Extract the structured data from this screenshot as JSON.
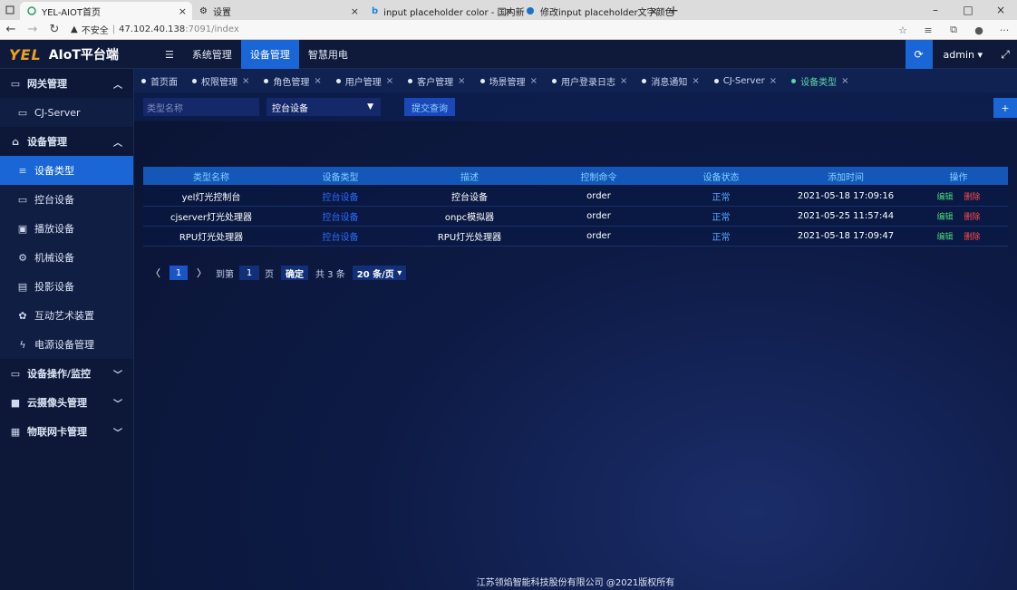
{
  "browser": {
    "tabs": [
      {
        "label": "YEL-AIOT首页",
        "active": true
      },
      {
        "label": "设置",
        "active": false
      },
      {
        "label": "input placeholder color - 国内新",
        "active": false
      },
      {
        "label": "修改input placeholder文字颜色",
        "active": false
      }
    ],
    "security": "不安全",
    "host": "47.102.40.138",
    "path": ":7091/index"
  },
  "header": {
    "brand": "YEL",
    "title": "AIoT平台端",
    "menu": [
      "系统管理",
      "设备管理",
      "智慧用电"
    ],
    "active_menu": "设备管理",
    "user": "admin"
  },
  "sidebar": {
    "items": [
      {
        "label": "网关管理",
        "icon": "monitor-icon",
        "type": "group",
        "expanded": true
      },
      {
        "label": "CJ-Server",
        "icon": "monitor-icon",
        "type": "sub"
      },
      {
        "label": "设备管理",
        "icon": "home-icon",
        "type": "group",
        "expanded": true
      },
      {
        "label": "设备类型",
        "icon": "list-icon",
        "type": "sub",
        "active": true
      },
      {
        "label": "控台设备",
        "icon": "laptop-icon",
        "type": "sub"
      },
      {
        "label": "播放设备",
        "icon": "film-icon",
        "type": "sub"
      },
      {
        "label": "机械设备",
        "icon": "gears-icon",
        "type": "sub"
      },
      {
        "label": "投影设备",
        "icon": "projector-icon",
        "type": "sub"
      },
      {
        "label": "互动艺术装置",
        "icon": "art-icon",
        "type": "sub"
      },
      {
        "label": "电源设备管理",
        "icon": "power-icon",
        "type": "sub"
      },
      {
        "label": "设备操作/监控",
        "icon": "desktop-icon",
        "type": "group",
        "expanded": false
      },
      {
        "label": "云摄像头管理",
        "icon": "camera-icon",
        "type": "group",
        "expanded": false
      },
      {
        "label": "物联网卡管理",
        "icon": "calendar-icon",
        "type": "group",
        "expanded": false
      }
    ]
  },
  "tabs": [
    {
      "label": "首页面",
      "closable": false
    },
    {
      "label": "权限管理",
      "closable": true
    },
    {
      "label": "角色管理",
      "closable": true
    },
    {
      "label": "用户管理",
      "closable": true
    },
    {
      "label": "客户管理",
      "closable": true
    },
    {
      "label": "场景管理",
      "closable": true
    },
    {
      "label": "用户登录日志",
      "closable": true
    },
    {
      "label": "消息通知",
      "closable": true
    },
    {
      "label": "CJ-Server",
      "closable": true
    },
    {
      "label": "设备类型",
      "closable": true,
      "active": true
    }
  ],
  "filter": {
    "name_placeholder": "类型名称",
    "category_value": "控台设备",
    "submit_label": "提交查询",
    "add_label": "+"
  },
  "table": {
    "columns": [
      "类型名称",
      "设备类型",
      "描述",
      "控制命令",
      "设备状态",
      "添加时间",
      "操作"
    ],
    "rows": [
      {
        "name": "yel灯光控制台",
        "type": "控台设备",
        "desc": "控台设备",
        "cmd": "order",
        "status": "正常",
        "time": "2021-05-18 17:09:16",
        "edit": "编辑",
        "del": "删除"
      },
      {
        "name": "cjserver灯光处理器",
        "type": "控台设备",
        "desc": "onpc模拟器",
        "cmd": "order",
        "status": "正常",
        "time": "2021-05-25 11:57:44",
        "edit": "编辑",
        "del": "删除"
      },
      {
        "name": "RPU灯光处理器",
        "type": "控台设备",
        "desc": "RPU灯光处理器",
        "cmd": "order",
        "status": "正常",
        "time": "2021-05-18 17:09:47",
        "edit": "编辑",
        "del": "删除"
      }
    ]
  },
  "pager": {
    "current": "1",
    "goto_label": "到第",
    "goto_value": "1",
    "page_unit": "页",
    "confirm": "确定",
    "total": "共 3 条",
    "size": "20 条/页"
  },
  "footer": "江苏领焰智能科技股份有限公司 @2021版权所有",
  "colors": {
    "accent": "#1a66d6",
    "brand": "#f0a020",
    "active_tab": "#5ed7a8",
    "delete": "#ff4a4a",
    "edit": "#49d37a"
  }
}
